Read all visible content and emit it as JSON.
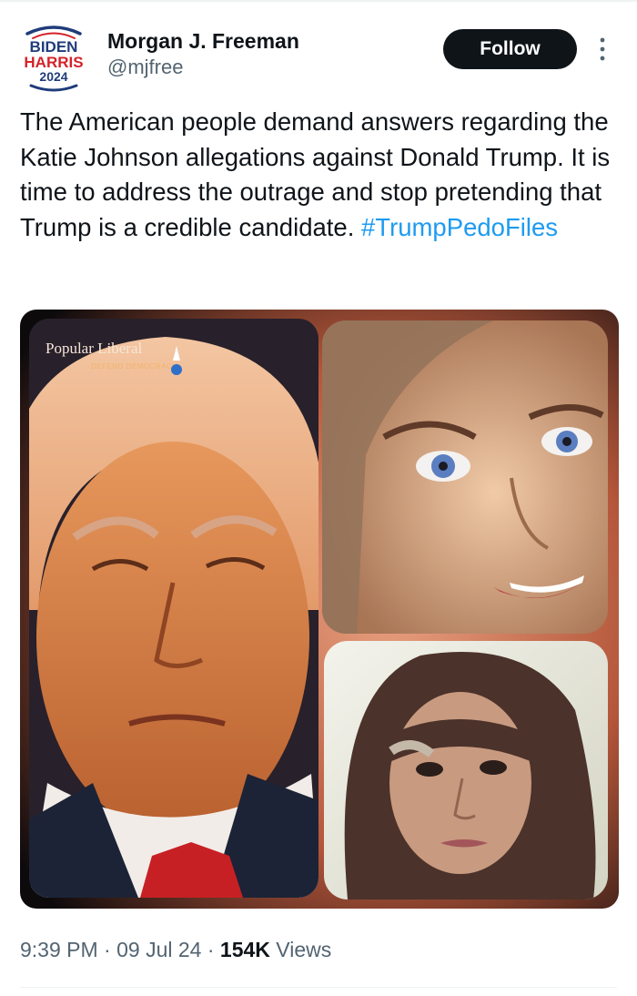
{
  "header": {
    "avatar": {
      "line1": "BIDEN",
      "line2": "HARRIS",
      "line3": "2024"
    },
    "display_name": "Morgan J. Freeman",
    "handle": "@mjfree",
    "follow_label": "Follow"
  },
  "tweet": {
    "text": "The American people demand answers regarding the Katie Johnson allegations against Donald Trump. It is time to address the outrage and stop pretending that Trump is a credible candidate. ",
    "hashtag": "#TrumpPedoFiles"
  },
  "media": {
    "watermark_title": "Popular Liberal",
    "watermark_subtitle": "DEFEND DEMOCRACY"
  },
  "meta": {
    "time": "9:39 PM",
    "sep1": " · ",
    "date": "09 Jul 24",
    "sep2": " · ",
    "views_count": "154K",
    "views_label": " Views"
  },
  "colors": {
    "text": "#0f1419",
    "secondary": "#536471",
    "link": "#1d9bf0",
    "avatar_blue": "#1f3c7a",
    "avatar_red": "#d4232b"
  }
}
